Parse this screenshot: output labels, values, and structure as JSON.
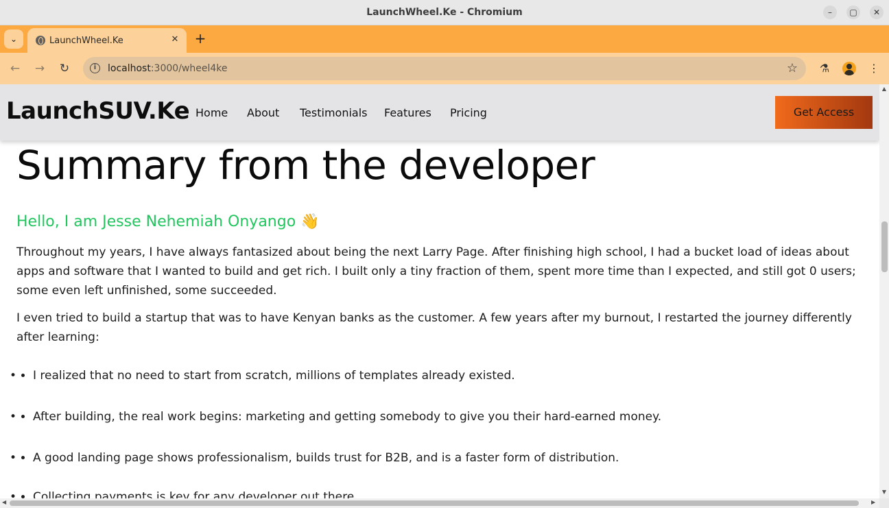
{
  "window": {
    "title": "LaunchWheel.Ke - Chromium",
    "minimize_glyph": "–",
    "maximize_glyph": "▢",
    "close_glyph": "✕"
  },
  "browser": {
    "tab_menu_glyph": "⌄",
    "tab": {
      "title": "LaunchWheel.Ke",
      "close_glyph": "✕"
    },
    "new_tab_glyph": "+",
    "nav": {
      "back": "←",
      "forward": "→",
      "reload": "↻"
    },
    "address": {
      "info_glyph": "i",
      "host": "localhost",
      "path": ":3000/wheel4ke",
      "star_glyph": "☆"
    },
    "toolbar_icons": {
      "labs": "⚗",
      "menu": "⋮"
    }
  },
  "site": {
    "brand": "LaunchSUV.Ke",
    "nav": [
      "Home",
      "About",
      "Testimonials",
      "Features",
      "Pricing"
    ],
    "cta": "Get Access"
  },
  "main": {
    "heading": "Summary from the developer",
    "greeting": "Hello, I am Jesse Nehemiah Onyango",
    "greeting_emoji": "👋",
    "paragraphs": [
      "Throughout my years, I have always fantasized about being the next Larry Page. After finishing high school, I had a bucket load of ideas about apps and software that I wanted to build and get rich. I built only a tiny fraction of them, spent more time than I expected, and still got 0 users; some even left unfinished, some succeeded.",
      "I even tried to build a startup that was to have Kenyan banks as the customer. A few years after my burnout, I restarted the journey differently after learning:"
    ],
    "list": [
      "I realized that no need to start from scratch, millions of templates already existed.",
      "After building, the real work begins: marketing and getting somebody to give you their hard-earned money.",
      "A good landing page shows professionalism, builds trust for B2B, and is a faster form of distribution.",
      "Collecting payments is key for any developer out there."
    ],
    "bullet_glyph": "•"
  },
  "colors": {
    "tab_strip": "#fda942",
    "toolbar": "#fdd29a",
    "greeting": "#22c55e",
    "cta_gradient_start": "#f06a1c",
    "cta_gradient_end": "#a3380f"
  }
}
